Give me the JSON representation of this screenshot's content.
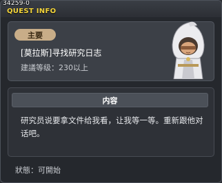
{
  "window": {
    "quest_id": "34259-0",
    "title": "QUEST INFO"
  },
  "quest": {
    "badge": "主要",
    "name": "[莫拉斯]寻找研究日志",
    "level_requirement": "建議等级：230以上",
    "npc_icon": "hooded-npc-portrait"
  },
  "content": {
    "header": "内容",
    "text": "研究员说要拿文件给我看，让我等一等。重新跟他对话吧。"
  },
  "status": {
    "label": "狀態：可開始"
  },
  "colors": {
    "title_yellow": "#f5d63a",
    "badge_tan": "#c8ad88",
    "panel_bg": "#3c4047"
  }
}
